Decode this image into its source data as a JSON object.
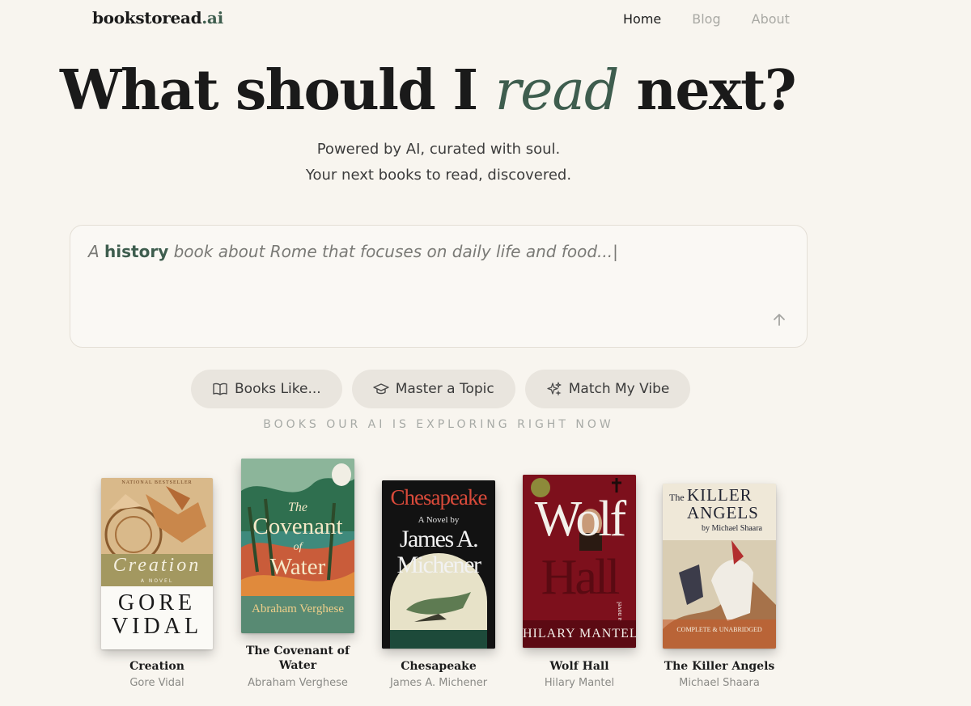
{
  "brand": {
    "name": "bookstoread",
    "suffix": ".ai"
  },
  "nav": {
    "home": "Home",
    "blog": "Blog",
    "about": "About"
  },
  "hero": {
    "title_before": "What should I",
    "title_accent": "read",
    "title_after": "next?",
    "subtitle_1": "Powered by AI, curated with soul.",
    "subtitle_2": "Your next books to read, discovered."
  },
  "search": {
    "prefix": "A",
    "keyword": "history",
    "rest": "book about Rome that focuses on daily life and food...|"
  },
  "chips": {
    "books_like": "Books Like...",
    "master_topic": "Master a Topic",
    "match_vibe": "Match My Vibe"
  },
  "section_label": "BOOKS OUR AI IS EXPLORING RIGHT NOW",
  "books": [
    {
      "title": "Creation",
      "author": "Gore Vidal",
      "cover": {
        "top": "NATIONAL BESTSELLER",
        "band": "Creation",
        "sub": "A NOVEL",
        "name1": "GORE",
        "name2": "VIDAL"
      }
    },
    {
      "title": "The Covenant of Water",
      "author": "Abraham Verghese",
      "cover": {
        "line1": "The",
        "line2": "Covenant",
        "line3": "of",
        "line4": "Water",
        "name": "Abraham Verghese"
      }
    },
    {
      "title": "Chesapeake",
      "author": "James A. Michener",
      "cover": {
        "top": "Chesapeake",
        "sub": "A Novel by",
        "name1": "James A.",
        "name2": "Michener"
      }
    },
    {
      "title": "Wolf Hall",
      "author": "Hilary Mantel",
      "cover": {
        "line1": "Wolf",
        "line2": "Hall",
        "side": "a novel",
        "name": "HILARY MANTEL"
      }
    },
    {
      "title": "The Killer Angels",
      "author": "Michael Shaara",
      "cover": {
        "line1": "The",
        "line2": "KILLER",
        "line3": "ANGELS",
        "sub": "by Michael Shaara",
        "bottom": "COMPLETE & UNABRIDGED"
      }
    }
  ],
  "colors": {
    "accent": "#3e5d4e",
    "background": "#f8f5ef",
    "chip": "#e9e5de"
  }
}
